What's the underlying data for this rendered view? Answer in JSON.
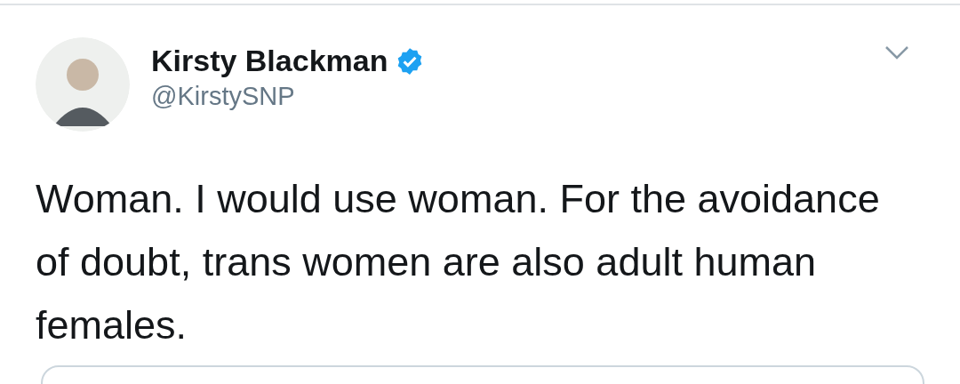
{
  "tweet": {
    "author": {
      "name": "Kirsty Blackman",
      "verified": true,
      "handle": "@KirstySNP"
    },
    "text": "Woman. I would use woman. For the avoidance of doubt, trans women are also adult human females.",
    "has_quoted_card": true
  }
}
